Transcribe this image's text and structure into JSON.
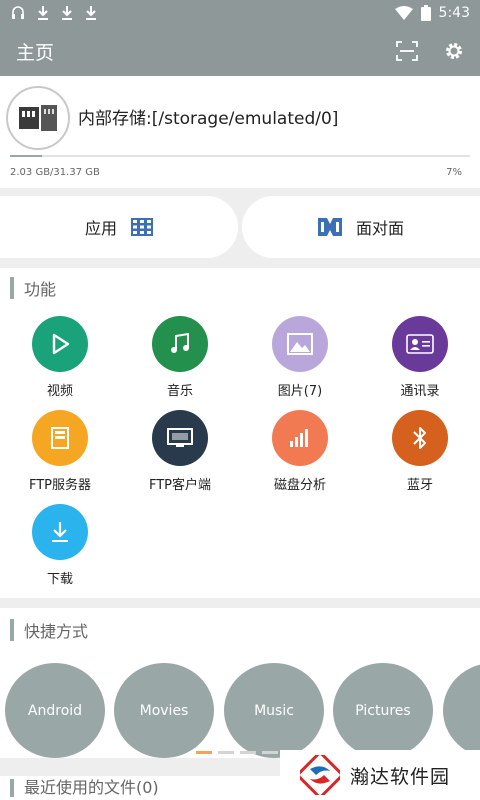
{
  "status": {
    "time": "5:43",
    "icons": [
      "headset-icon",
      "download-icon",
      "download-icon",
      "download-icon",
      "wifi-icon",
      "battery-icon"
    ]
  },
  "appbar": {
    "title": "主页",
    "actions": [
      "scan-icon",
      "gear-icon"
    ]
  },
  "storage": {
    "path": "内部存储:[/storage/emulated/0]",
    "size": "2.03 GB/31.37 GB",
    "percent": "7%",
    "used_fraction": 0.07
  },
  "quick": {
    "apps_label": "应用",
    "face_label": "面对面"
  },
  "functions": {
    "title": "功能",
    "items": [
      {
        "label": "视频",
        "color": "#1aa37a",
        "icon": "play-icon"
      },
      {
        "label": "音乐",
        "color": "#24904e",
        "icon": "music-note-icon"
      },
      {
        "label": "图片(7)",
        "color": "#b9a7dc",
        "icon": "image-icon"
      },
      {
        "label": "通讯录",
        "color": "#6a3a9a",
        "icon": "contact-card-icon"
      },
      {
        "label": "FTP服务器",
        "color": "#f5a623",
        "icon": "ftp-server-icon"
      },
      {
        "label": "FTP客户端",
        "color": "#283a4c",
        "icon": "ftp-client-icon"
      },
      {
        "label": "磁盘分析",
        "color": "#f27a52",
        "icon": "bar-chart-icon"
      },
      {
        "label": "蓝牙",
        "color": "#d6601e",
        "icon": "bluetooth-icon"
      },
      {
        "label": "下载",
        "color": "#2bb3ee",
        "icon": "download-arrow-icon"
      }
    ]
  },
  "shortcuts": {
    "title": "快捷方式",
    "items": [
      "Android",
      "Movies",
      "Music",
      "Pictures",
      ""
    ]
  },
  "recent": {
    "title": "最近使用的文件(0)"
  },
  "watermark": {
    "text": "瀚达软件园"
  }
}
